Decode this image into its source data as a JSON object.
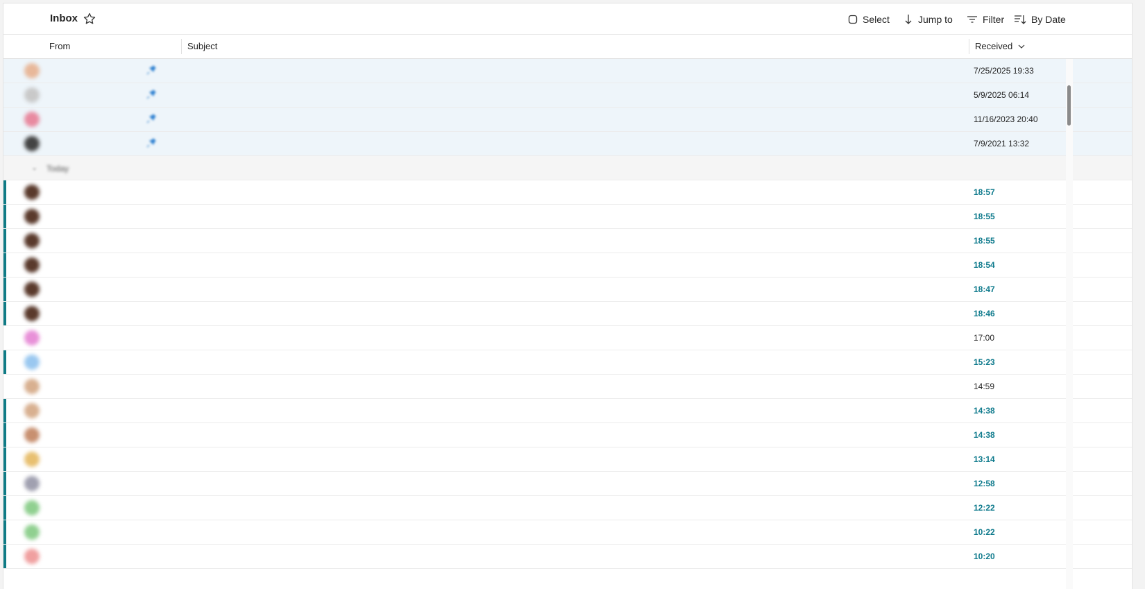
{
  "toolbar": {
    "title": "Inbox",
    "select_label": "Select",
    "jump_label": "Jump to",
    "filter_label": "Filter",
    "sort_label": "By Date"
  },
  "columns": {
    "from": "From",
    "subject": "Subject",
    "received": "Received"
  },
  "group_label": "Today",
  "emails": [
    {
      "from": "",
      "subject": "",
      "preview": "",
      "received": "7/25/2025 19:33",
      "avatar_color": "#e8b89a"
    },
    {
      "from": "",
      "subject": "",
      "preview": "",
      "received": "5/9/2025 06:14",
      "avatar_color": "#c9c9c9"
    },
    {
      "from": "",
      "subject": "",
      "preview": "",
      "received": "11/16/2023 20:40",
      "avatar_color": "#e88aa0"
    },
    {
      "from": "",
      "subject": "",
      "preview": "",
      "received": "7/9/2021 13:32",
      "avatar_color": "#444444"
    },
    {
      "from": "",
      "subject": "",
      "preview": "",
      "received": "18:57",
      "avatar_color": "#5a3a2c"
    },
    {
      "from": "",
      "subject": "",
      "preview": "",
      "received": "18:55",
      "avatar_color": "#5a3a2c"
    },
    {
      "from": "",
      "subject": "",
      "preview": "",
      "received": "18:55",
      "avatar_color": "#5a3a2c"
    },
    {
      "from": "",
      "subject": "",
      "preview": "",
      "received": "18:54",
      "avatar_color": "#5a3a2c"
    },
    {
      "from": "",
      "subject": "",
      "preview": "",
      "received": "18:47",
      "avatar_color": "#5a3a2c"
    },
    {
      "from": "",
      "subject": "",
      "preview": "",
      "received": "18:46",
      "avatar_color": "#5a3a2c"
    },
    {
      "from": "",
      "subject": "",
      "preview": "",
      "received": "17:00",
      "avatar_color": "#e890d8"
    },
    {
      "from": "",
      "subject": "",
      "preview": "",
      "received": "15:23",
      "avatar_color": "#9ac8f0"
    },
    {
      "from": "",
      "subject": "",
      "preview": "",
      "received": "14:59",
      "avatar_color": "#d8b090"
    },
    {
      "from": "",
      "subject": "",
      "preview": "",
      "received": "14:38",
      "avatar_color": "#d8b090"
    },
    {
      "from": "",
      "subject": "",
      "preview": "",
      "received": "14:38",
      "avatar_color": "#c89070"
    },
    {
      "from": "",
      "subject": "",
      "preview": "",
      "received": "13:14",
      "avatar_color": "#e8c070"
    },
    {
      "from": "",
      "subject": "",
      "preview": "",
      "received": "12:58",
      "avatar_color": "#a0a0b0"
    },
    {
      "from": "",
      "subject": "",
      "preview": "",
      "received": "12:22",
      "avatar_color": "#90d090"
    },
    {
      "from": "",
      "subject": "",
      "preview": "",
      "received": "10:22",
      "avatar_color": "#90d090"
    },
    {
      "from": "",
      "subject": "",
      "preview": "",
      "received": "10:20",
      "avatar_color": "#f0a0a0"
    }
  ],
  "accent_color": "#0e7a8c"
}
